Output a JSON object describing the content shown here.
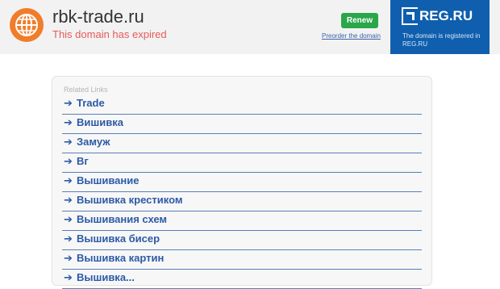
{
  "header": {
    "domain": "rbk-trade.ru",
    "status": "This domain has expired",
    "renew_label": "Renew",
    "preorder_label": "Preorder the domain"
  },
  "registrar": {
    "logo_text": "REG.RU",
    "note": "The domain is registered in REG.RU"
  },
  "related": {
    "title": "Related Links",
    "arrow": "➔",
    "items": [
      "Trade",
      "Вишивка",
      "Замуж",
      "Вг",
      "Вышивание",
      "Вышивка крестиком",
      "Вышивания схем",
      "Вышивка бисер",
      "Вышивка картин",
      "Вышивка..."
    ]
  },
  "colors": {
    "globe": "#f07d2a",
    "renew": "#2aa64b",
    "registrar_panel": "#0f5fae",
    "link": "#2d5aa6",
    "expired": "#e85a5a"
  }
}
